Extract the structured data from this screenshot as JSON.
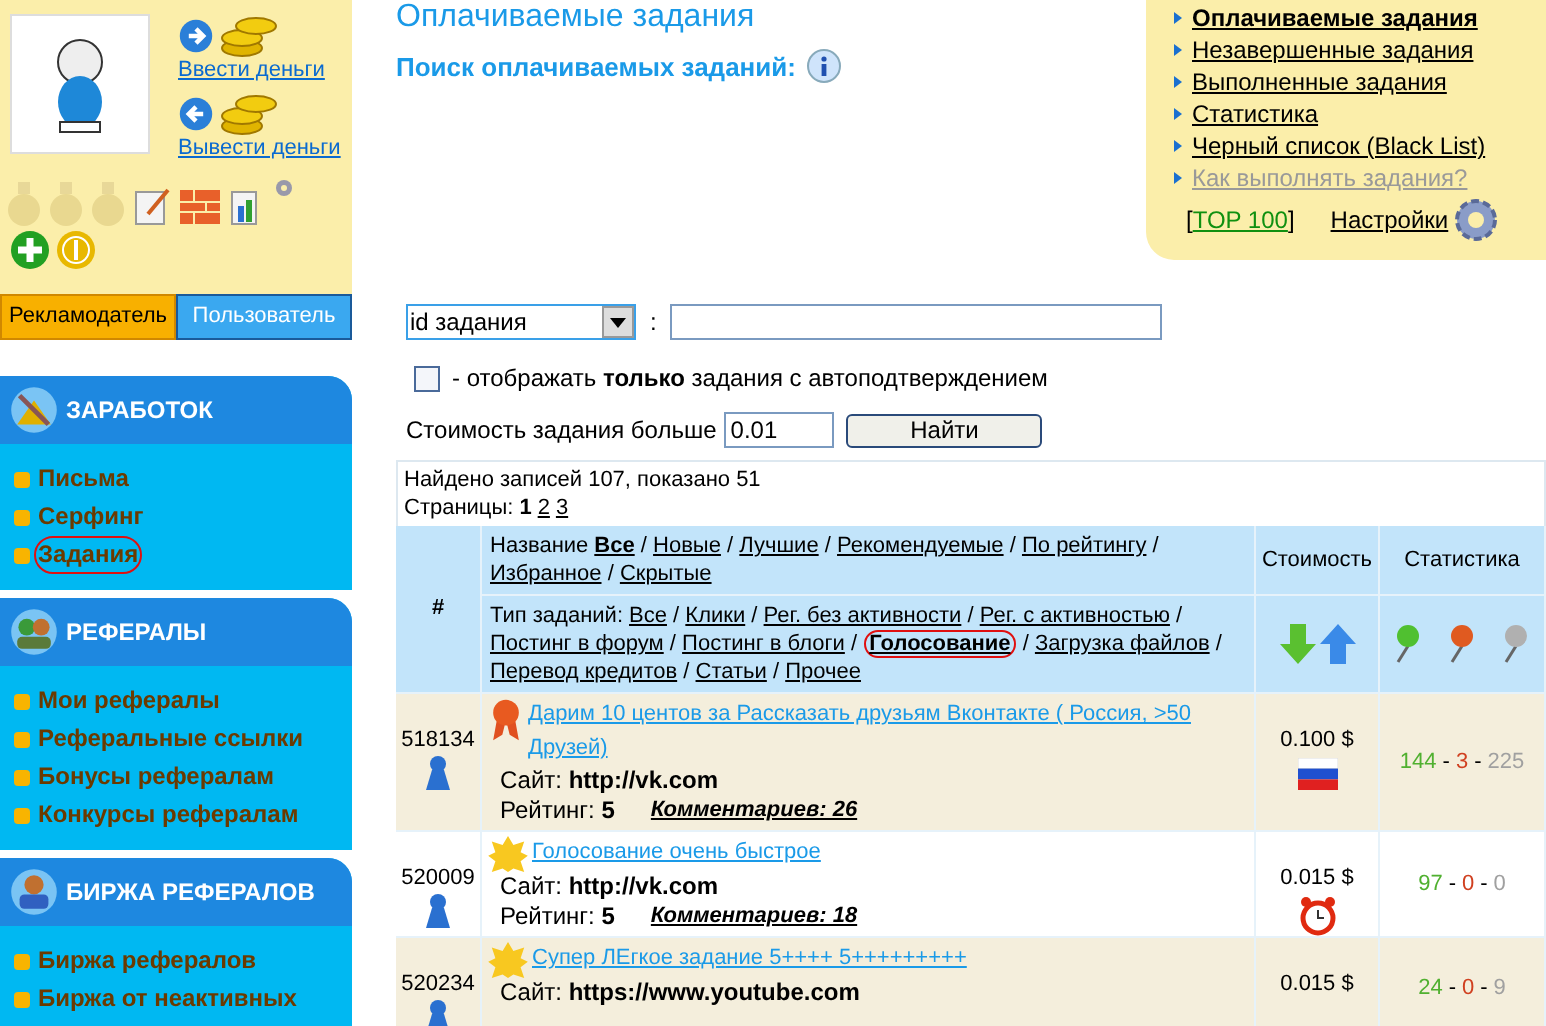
{
  "account": {
    "deposit": "Ввести деньги",
    "withdraw": "Вывести деньги",
    "tabs": [
      {
        "label": "Рекламодатель",
        "selected": false
      },
      {
        "label": "Пользователь",
        "selected": true
      }
    ]
  },
  "menu": [
    {
      "title": "ЗАРАБОТОК",
      "kind": "earn",
      "items": [
        {
          "label": "Письма",
          "circled": false
        },
        {
          "label": "Серфинг",
          "circled": false
        },
        {
          "label": "Задания",
          "circled": true
        }
      ]
    },
    {
      "title": "РЕФЕРАЛЫ",
      "kind": "referrals",
      "items": [
        {
          "label": "Мои рефералы",
          "circled": false
        },
        {
          "label": "Реферальные ссылки",
          "circled": false
        },
        {
          "label": "Бонусы рефералам",
          "circled": false
        },
        {
          "label": "Конкурсы рефералам",
          "circled": false
        }
      ]
    },
    {
      "title": "БИРЖА РЕФЕРАЛОВ",
      "kind": "exchange",
      "items": [
        {
          "label": "Биржа рефералов",
          "circled": false
        },
        {
          "label": "Биржа от неактивных",
          "circled": false
        }
      ]
    }
  ],
  "page_title": "Оплачиваемые задания",
  "search_title": "Поиск оплачиваемых заданий:",
  "links": [
    {
      "label": "Оплачиваемые задания",
      "selected": true,
      "disabled": false
    },
    {
      "label": "Незавершенные задания",
      "selected": false,
      "disabled": false
    },
    {
      "label": "Выполненные задания",
      "selected": false,
      "disabled": false
    },
    {
      "label": "Статистика",
      "selected": false,
      "disabled": false
    },
    {
      "label": "Черный список (Black List)",
      "selected": false,
      "disabled": false
    },
    {
      "label": "Как выполнять задания?",
      "selected": false,
      "disabled": true
    }
  ],
  "top_link": {
    "open": "[",
    "label": "TOP 100",
    "close": "]"
  },
  "settings": "Настройки",
  "search": {
    "field": "id задания",
    "separator": ":"
  },
  "auto_confirm": {
    "checked": false,
    "text": "- отображать **только** задания с автоподтверждением"
  },
  "min_price": {
    "label": "Стоимость задания больше",
    "value": "0.01",
    "button": "Найти"
  },
  "found": "Найдено записей 107, показано 51",
  "pages_label": "Страницы:",
  "pages": [
    {
      "label": "1",
      "selected": true
    },
    {
      "label": "2",
      "selected": false
    },
    {
      "label": "3",
      "selected": false
    }
  ],
  "columns": {
    "number": "#",
    "cost": "Стоимость",
    "stats": "Статистика"
  },
  "name_filter": {
    "label": "Название",
    "separator": "/",
    "options": [
      {
        "label": "Все",
        "selected": true,
        "circled": false
      },
      {
        "label": "Новые",
        "selected": false,
        "circled": false
      },
      {
        "label": "Лучшие",
        "selected": false,
        "circled": false
      },
      {
        "label": "Рекомендуемые",
        "selected": false,
        "circled": false
      },
      {
        "label": "По рейтингу",
        "selected": false,
        "circled": false
      },
      {
        "label": "Избранное",
        "selected": false,
        "circled": false
      },
      {
        "label": "Скрытые",
        "selected": false,
        "circled": false
      }
    ]
  },
  "type_filter": {
    "label": "Тип заданий:",
    "separator": "/",
    "options": [
      {
        "label": "Все",
        "selected": false,
        "circled": false
      },
      {
        "label": "Клики",
        "selected": false,
        "circled": false
      },
      {
        "label": "Рег. без активности",
        "selected": false,
        "circled": false
      },
      {
        "label": "Рег. с активностью",
        "selected": false,
        "circled": false
      },
      {
        "label": "Постинг в форум",
        "selected": false,
        "circled": false
      },
      {
        "label": "Постинг в блоги",
        "selected": false,
        "circled": false
      },
      {
        "label": "Голосование",
        "selected": true,
        "circled": true
      },
      {
        "label": "Загрузка файлов",
        "selected": false,
        "circled": false
      },
      {
        "label": "Перевод кредитов",
        "selected": false,
        "circled": false
      },
      {
        "label": "Статьи",
        "selected": false,
        "circled": false
      },
      {
        "label": "Прочее",
        "selected": false,
        "circled": false
      }
    ]
  },
  "rows": [
    {
      "id": "518134",
      "badge": {
        "kind": "award"
      },
      "title": "Дарим 10 центов за Рассказать друзьям Вконтакте ( Россия, >50 Друзей)",
      "site_label": "Сайт:",
      "site": "http://vk.com",
      "rating_label": "Рейтинг:",
      "rating": "5",
      "comments": "Комментариев: 26",
      "price": "0.100 $",
      "marker": {
        "kind": "flag"
      },
      "stats": [
        "144",
        "3",
        "225"
      ],
      "stats_separator": "-"
    },
    {
      "id": "520009",
      "badge": {
        "kind": "new"
      },
      "title": "Голосование очень быстрое",
      "site_label": "Сайт:",
      "site": "http://vk.com",
      "rating_label": "Рейтинг:",
      "rating": "5",
      "comments": "Комментариев: 18",
      "price": "0.015 $",
      "marker": {
        "kind": "clock"
      },
      "stats": [
        "97",
        "0",
        "0"
      ],
      "stats_separator": "-"
    },
    {
      "id": "520234",
      "badge": {
        "kind": "new"
      },
      "title": "Супер ЛЕгкое задание 5++++ 5+++++++++",
      "site_label": "Сайт:",
      "site": "https://www.youtube.com",
      "price": "0.015 $",
      "stats": [
        "24",
        "0",
        "9"
      ],
      "stats_separator": "-"
    }
  ]
}
